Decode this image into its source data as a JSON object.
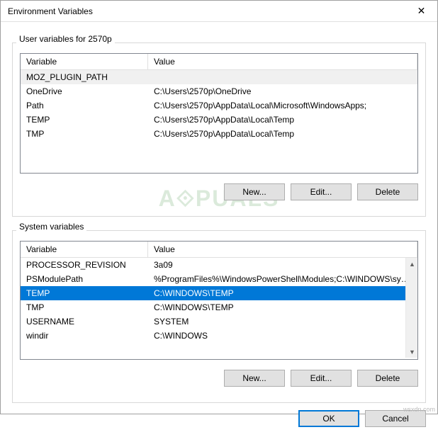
{
  "window": {
    "title": "Environment Variables",
    "close_icon": "✕"
  },
  "user_section": {
    "label": "User variables for 2570p",
    "columns": {
      "var": "Variable",
      "val": "Value"
    },
    "rows": [
      {
        "var": "MOZ_PLUGIN_PATH",
        "val": ""
      },
      {
        "var": "OneDrive",
        "val": "C:\\Users\\2570p\\OneDrive"
      },
      {
        "var": "Path",
        "val": "C:\\Users\\2570p\\AppData\\Local\\Microsoft\\WindowsApps;"
      },
      {
        "var": "TEMP",
        "val": "C:\\Users\\2570p\\AppData\\Local\\Temp"
      },
      {
        "var": "TMP",
        "val": "C:\\Users\\2570p\\AppData\\Local\\Temp"
      }
    ],
    "selected_index": 0,
    "selection_active": false,
    "buttons": {
      "new": "New...",
      "edit": "Edit...",
      "del": "Delete"
    }
  },
  "system_section": {
    "label": "System variables",
    "columns": {
      "var": "Variable",
      "val": "Value"
    },
    "rows": [
      {
        "var": "PROCESSOR_REVISION",
        "val": "3a09"
      },
      {
        "var": "PSModulePath",
        "val": "%ProgramFiles%\\WindowsPowerShell\\Modules;C:\\WINDOWS\\syst..."
      },
      {
        "var": "TEMP",
        "val": "C:\\WINDOWS\\TEMP"
      },
      {
        "var": "TMP",
        "val": "C:\\WINDOWS\\TEMP"
      },
      {
        "var": "USERNAME",
        "val": "SYSTEM"
      },
      {
        "var": "windir",
        "val": "C:\\WINDOWS"
      }
    ],
    "selected_index": 2,
    "selection_active": true,
    "buttons": {
      "new": "New...",
      "edit": "Edit...",
      "del": "Delete"
    }
  },
  "footer": {
    "ok": "OK",
    "cancel": "Cancel"
  },
  "watermark": "A⟐PUALS",
  "wsxdn": "wsxdn.com"
}
